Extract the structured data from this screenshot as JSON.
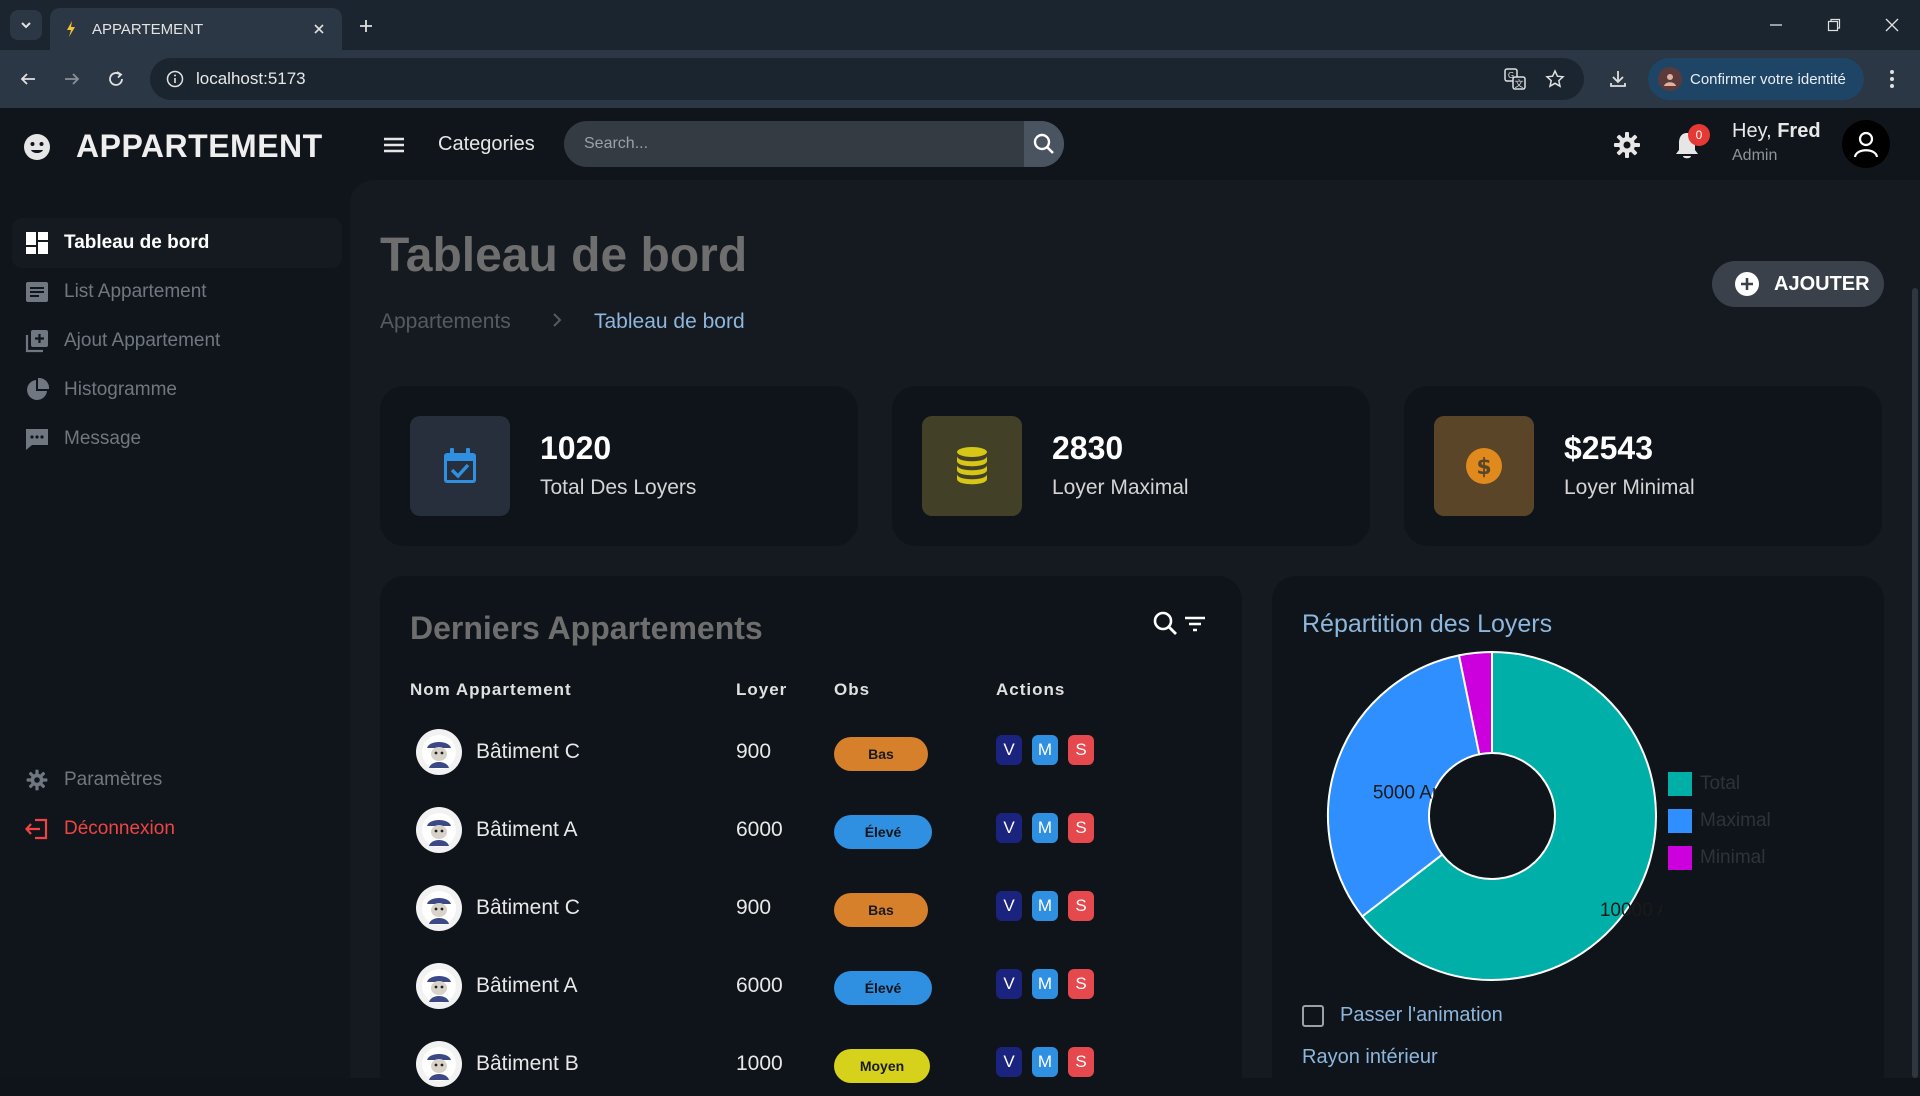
{
  "browser": {
    "tab_title": "APPARTEMENT",
    "url": "localhost:5173",
    "identity_label": "Confirmer votre identité"
  },
  "header": {
    "brand": "APPARTEMENT",
    "categories": "Categories",
    "search_placeholder": "Search...",
    "notifications_count": "0",
    "greeting": "Hey,",
    "user_name": "Fred",
    "user_role": "Admin"
  },
  "sidebar": {
    "items": [
      {
        "label": "Tableau de bord",
        "icon": "dashboard-icon"
      },
      {
        "label": "List Appartement",
        "icon": "list-icon"
      },
      {
        "label": "Ajout Appartement",
        "icon": "add-library-icon"
      },
      {
        "label": "Histogramme",
        "icon": "pie-chart-icon"
      },
      {
        "label": "Message",
        "icon": "message-icon"
      }
    ],
    "settings": "Paramètres",
    "logout": "Déconnexion"
  },
  "page": {
    "title": "Tableau de bord",
    "breadcrumb": [
      "Appartements",
      "Tableau de bord"
    ],
    "add_label": "AJOUTER"
  },
  "cards": [
    {
      "value": "1020",
      "label": "Total Des Loyers",
      "icon": "calendar-check-icon",
      "icon_color": "#2f8fe0",
      "bg": "#262f3b"
    },
    {
      "value": "2830",
      "label": "Loyer Maximal",
      "icon": "coins-stack-icon",
      "icon_color": "#d6c615",
      "bg": "#434028"
    },
    {
      "value": "$2543",
      "label": "Loyer Minimal",
      "icon": "dollar-coin-icon",
      "icon_color": "#e08a1e",
      "bg": "#5a4528"
    }
  ],
  "table": {
    "title": "Derniers Appartements",
    "columns": [
      "Nom Appartement",
      "Loyer",
      "Obs",
      "Actions"
    ],
    "action_labels": [
      "V",
      "M",
      "S"
    ],
    "rows": [
      {
        "name": "Bâtiment C",
        "loyer": "900",
        "obs": "Bas"
      },
      {
        "name": "Bâtiment A",
        "loyer": "6000",
        "obs": "Élevé"
      },
      {
        "name": "Bâtiment C",
        "loyer": "900",
        "obs": "Bas"
      },
      {
        "name": "Bâtiment A",
        "loyer": "6000",
        "obs": "Élevé"
      },
      {
        "name": "Bâtiment B",
        "loyer": "1000",
        "obs": "Moyen"
      }
    ],
    "obs_colors": {
      "Bas": "#d7802c",
      "Élevé": "#2f8fe0",
      "Moyen": "#d6d21c"
    }
  },
  "chart_panel": {
    "title": "Répartition des Loyers",
    "animation_label": "Passer l'animation",
    "inner_radius_label": "Rayon intérieur"
  },
  "chart_data": {
    "type": "pie",
    "donut": true,
    "categories": [
      "Total",
      "Maximal",
      "Minimal"
    ],
    "values": [
      10000,
      5000,
      500
    ],
    "colors": [
      "#00b0a8",
      "#2f8fff",
      "#cc00dd"
    ],
    "data_labels": [
      "10000 Ar",
      "5000 Ar",
      ""
    ],
    "legend_position": "right"
  }
}
